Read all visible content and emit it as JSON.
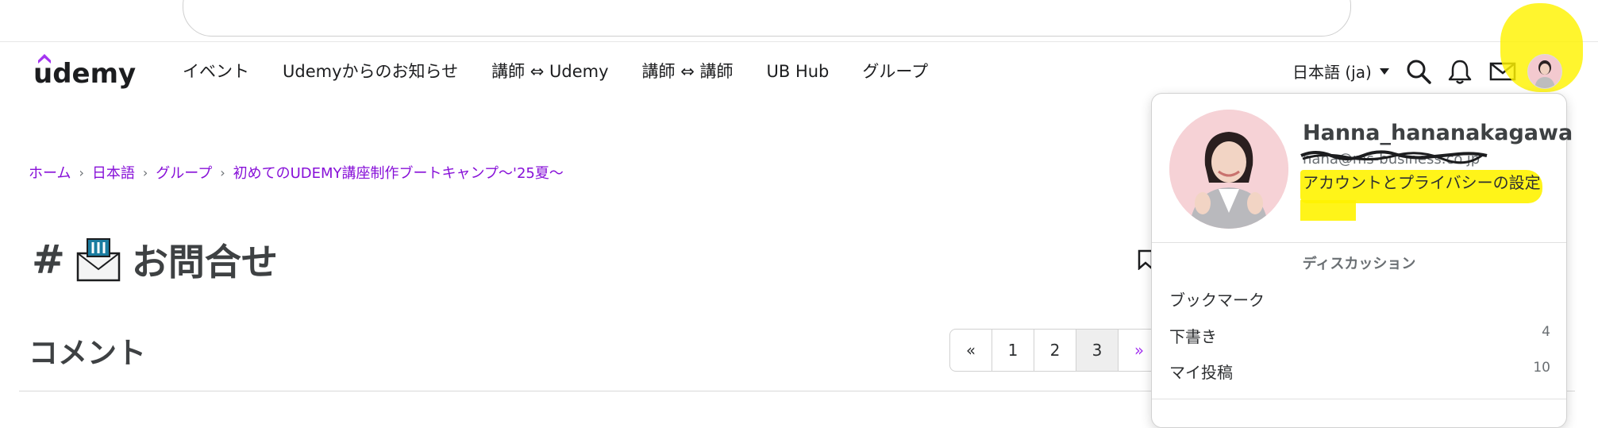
{
  "header": {
    "logo_text": "udemy",
    "nav": [
      "イベント",
      "Udemyからのお知らせ",
      "講師 ⇔ Udemy",
      "講師 ⇔ 講師",
      "UB Hub",
      "グループ"
    ],
    "language": "日本語 (ja)",
    "icons": [
      "search-icon",
      "bell-icon",
      "mail-icon",
      "avatar"
    ],
    "accent": "#a435f0",
    "highlight": "#fff300"
  },
  "breadcrumb": [
    "ホーム",
    "日本語",
    "グループ",
    "初めてのUDEMY講座制作ブートキャンプ〜'25夏〜"
  ],
  "page": {
    "title_hash": "#",
    "title": "お問合せ",
    "section": "コメント"
  },
  "pagination": {
    "first": "«",
    "pages": [
      "1",
      "2",
      "3"
    ],
    "current": "3",
    "next": "»"
  },
  "dropdown": {
    "username": "Hanna_hananakagawa",
    "email": "hana@ms-business.co.jp",
    "account_link": "アカウントとプライバシーの設定",
    "section_title": "ディスカッション",
    "items": [
      {
        "label": "ブックマーク",
        "count": ""
      },
      {
        "label": "下書き",
        "count": "4"
      },
      {
        "label": "マイ投稿",
        "count": "10"
      }
    ]
  }
}
